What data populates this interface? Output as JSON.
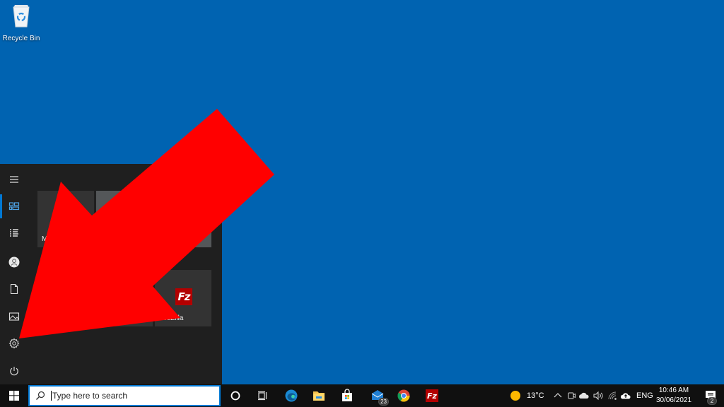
{
  "desktop": {
    "background": "#0063b1",
    "icons": [
      {
        "label": "Recycle Bin",
        "icon": "recycle-bin-icon"
      }
    ]
  },
  "start_menu": {
    "rail": [
      {
        "name": "expand",
        "icon": "hamburger-menu-icon",
        "active": false
      },
      {
        "name": "pinned-tiles",
        "icon": "tiles-icon",
        "active": true
      },
      {
        "name": "all-apps",
        "icon": "list-icon",
        "active": false
      },
      {
        "name": "account",
        "icon": "user-icon",
        "active": false
      },
      {
        "name": "documents",
        "icon": "document-icon",
        "active": false
      },
      {
        "name": "pictures",
        "icon": "pictures-icon",
        "active": false
      },
      {
        "name": "settings",
        "icon": "gear-icon",
        "active": false
      },
      {
        "name": "power",
        "icon": "power-icon",
        "active": false
      }
    ],
    "tiles": [
      {
        "label": "M",
        "icon": ""
      },
      {
        "label": "",
        "icon": ""
      },
      {
        "label": "",
        "icon": ""
      },
      {
        "label": "FileZilla",
        "icon": "filezilla-icon"
      }
    ]
  },
  "annotation": {
    "type": "arrow",
    "color": "#ff0000",
    "points_to": "settings"
  },
  "taskbar": {
    "search": {
      "placeholder": "Type here to search",
      "value": ""
    },
    "apps": [
      {
        "name": "cortana",
        "icon": "cortana-circle-icon"
      },
      {
        "name": "task-view",
        "icon": "task-view-icon"
      },
      {
        "name": "edge",
        "icon": "edge-icon"
      },
      {
        "name": "file-explorer",
        "icon": "folder-icon"
      },
      {
        "name": "microsoft-store",
        "icon": "store-icon"
      },
      {
        "name": "mail",
        "icon": "mail-icon",
        "badge": "23"
      },
      {
        "name": "chrome",
        "icon": "chrome-icon"
      },
      {
        "name": "filezilla",
        "icon": "filezilla-icon"
      }
    ],
    "tray": {
      "weather_temp": "13°C",
      "language": "ENG",
      "time": "10:46 AM",
      "date": "30/06/2021",
      "notification_count": "2"
    }
  }
}
